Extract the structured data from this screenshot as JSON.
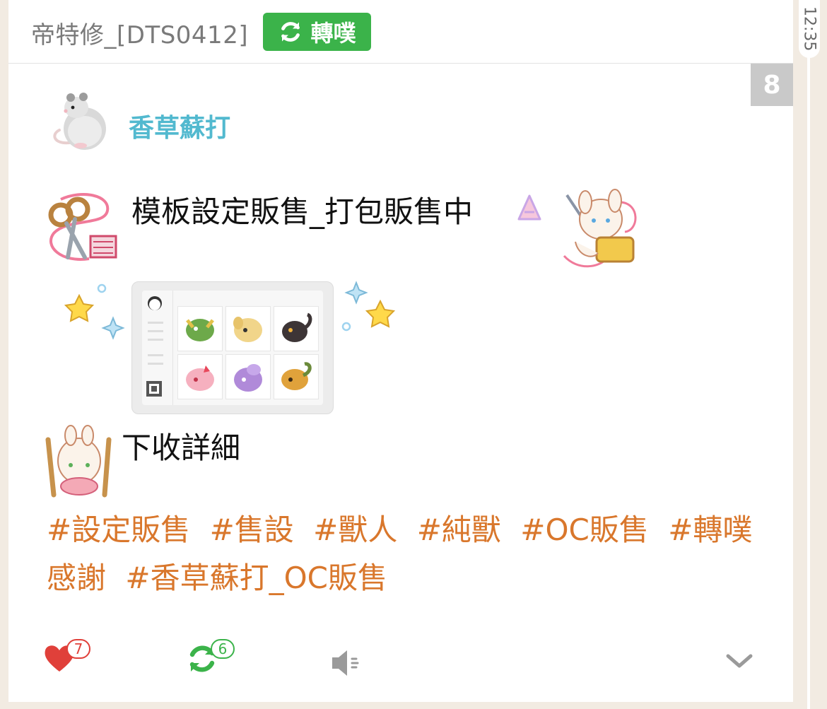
{
  "repost": {
    "reposter": "帝特修_[DTS0412]",
    "badge_label": "轉噗"
  },
  "response_count": "8",
  "post": {
    "author": "香草蘇打",
    "line1": "模板設定販售_打包販售中",
    "line2": "下收詳細"
  },
  "tags": [
    "#設定販售",
    "#售設",
    "#獸人",
    "#純獸",
    "#OC販售",
    "#轉噗感謝",
    "#香草蘇打_OC販售"
  ],
  "actions": {
    "like_count": "7",
    "replurk_count": "6"
  },
  "timestamp": "12:35",
  "colors": {
    "accent_green": "#3bb34a",
    "author_blue": "#52b9cf",
    "tag_orange": "#d9772c",
    "like_red": "#e0403a"
  },
  "icons": {
    "repost": "refresh-icon",
    "like": "heart-icon",
    "replurk": "replurk-icon",
    "mute": "speaker-mute-icon",
    "more": "chevron-down-icon"
  }
}
